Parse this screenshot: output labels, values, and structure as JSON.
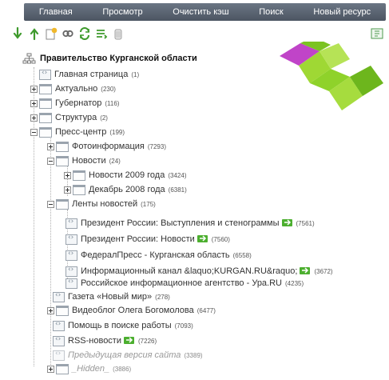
{
  "nav": {
    "home": "Главная",
    "view": "Просмотр",
    "clear_cache": "Очистить кэш",
    "search": "Поиск",
    "new_resource": "Новый ресурс"
  },
  "toolbar": {
    "icons": [
      "arrow-down-icon",
      "arrow-up-icon",
      "new-document-icon",
      "link-icon",
      "refresh-icon",
      "sort-icon",
      "trash-icon",
      "help-icon"
    ]
  },
  "tree": {
    "root": "Правительство Курганской области",
    "items": [
      {
        "label": "Главная страница",
        "count": "(1)"
      },
      {
        "label": "Актуально",
        "count": "(230)"
      },
      {
        "label": "Губернатор",
        "count": "(116)"
      },
      {
        "label": "Структура",
        "count": "(2)"
      },
      {
        "label": "Пресс-центр",
        "count": "(199)"
      },
      {
        "label": "Фотоинформация",
        "count": "(7293)"
      },
      {
        "label": "Новости",
        "count": "(24)"
      },
      {
        "label": "Новости 2009 года",
        "count": "(3424)"
      },
      {
        "label": "Декабрь 2008 года",
        "count": "(6381)"
      },
      {
        "label": "Ленты новостей",
        "count": "(175)"
      },
      {
        "label": "Президент России: Выступления и стенограммы",
        "count": "(7561)"
      },
      {
        "label": "Президент России: Новости",
        "count": "(7560)"
      },
      {
        "label": "ФедералПресс - Курганская область",
        "count": "(6558)"
      },
      {
        "label": "Информационный канал &laquo;KURGAN.RU&raquo;",
        "count": "(3672)"
      },
      {
        "label": "Российское информационное агентство - Ура.RU",
        "count": "(4235)"
      },
      {
        "label": "Газета «Новый мир»",
        "count": "(278)"
      },
      {
        "label": "Видеоблог Олега Богомолова",
        "count": "(6477)"
      },
      {
        "label": "Помощь в поиске работы",
        "count": "(7093)"
      },
      {
        "label": "RSS-новости",
        "count": "(7226)"
      },
      {
        "label": "Предыдущая версия сайта",
        "count": "(3389)"
      },
      {
        "label": "_Hidden_",
        "count": "(3886)"
      }
    ]
  },
  "colors": {
    "nav_bg": "#55606d",
    "logo_green": "#8fd22a",
    "logo_magenta": "#c044c8"
  }
}
